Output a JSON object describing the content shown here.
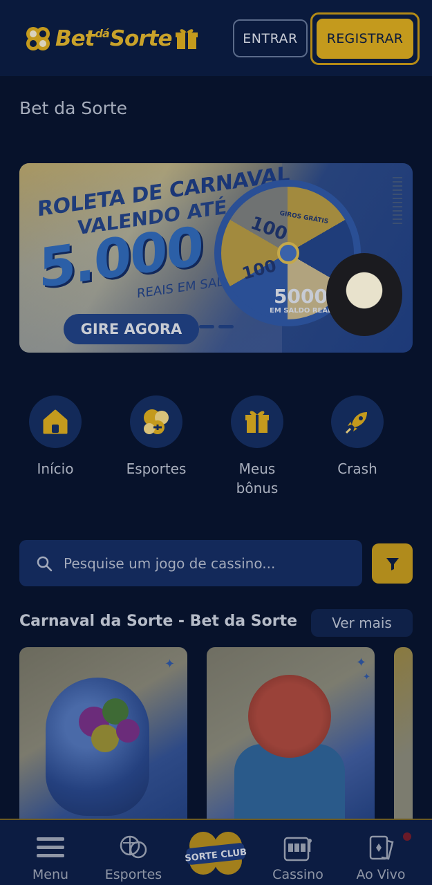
{
  "header": {
    "logo_alt": "Bet dá Sorte",
    "logo_part1": "Bet",
    "logo_part2": "dá",
    "logo_part3": "Sorte",
    "login_label": "ENTRAR",
    "register_label": "REGISTRAR"
  },
  "page_title": "Bet da Sorte",
  "banner": {
    "line1_prefix": "ROLETA DE ",
    "line1_emph": "CARNAVAL",
    "line2": "VALENDO ATÉ",
    "amount": "5.000",
    "sub": "REAIS EM SALDO",
    "cta": "GIRE AGORA",
    "wheel_labels": [
      "100",
      "100",
      "5000",
      "EM SALDO REAL",
      "GIROS GRÁTIS"
    ],
    "slide_index": 2,
    "slide_count": 3
  },
  "quick_links": [
    {
      "label": "Início",
      "icon": "home-icon"
    },
    {
      "label": "Esportes",
      "icon": "sports-balls-icon"
    },
    {
      "label": "Meus bônus",
      "icon": "gift-icon"
    },
    {
      "label": "Crash",
      "icon": "rocket-icon"
    }
  ],
  "search": {
    "placeholder": "Pesquise um jogo de cassino..."
  },
  "section": {
    "title": "Carnaval da Sorte - Bet da Sorte",
    "more_label": "Ver mais"
  },
  "bottom_nav": {
    "items": [
      {
        "label": "Menu",
        "icon": "hamburger-icon"
      },
      {
        "label": "Esportes",
        "icon": "sports-balls-icon"
      },
      {
        "label": "SORTE CLUB",
        "icon": "sorte-club-logo"
      },
      {
        "label": "Cassino",
        "icon": "slot-machine-icon"
      },
      {
        "label": "Ao Vivo",
        "icon": "cards-icon"
      }
    ]
  },
  "colors": {
    "background": "#07122b",
    "header": "#0a1a3d",
    "accent_gold": "#c49a1d",
    "navy": "#13295a"
  }
}
